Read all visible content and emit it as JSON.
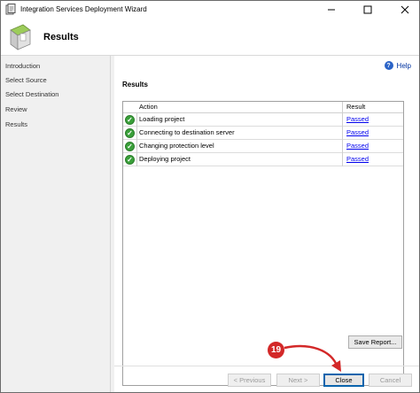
{
  "window": {
    "title": "Integration Services Deployment Wizard"
  },
  "header": {
    "title": "Results"
  },
  "nav": {
    "items": [
      {
        "label": "Introduction"
      },
      {
        "label": "Select Source"
      },
      {
        "label": "Select Destination"
      },
      {
        "label": "Review"
      },
      {
        "label": "Results"
      }
    ]
  },
  "content": {
    "help_label": "Help",
    "section_title": "Results",
    "columns": {
      "action": "Action",
      "result": "Result"
    },
    "rows": [
      {
        "action": "Loading project",
        "result": "Passed"
      },
      {
        "action": "Connecting to destination server",
        "result": "Passed"
      },
      {
        "action": "Changing protection level",
        "result": "Passed"
      },
      {
        "action": "Deploying project",
        "result": "Passed"
      }
    ],
    "save_report_label": "Save Report..."
  },
  "footer": {
    "previous_label": "< Previous",
    "next_label": "Next >",
    "close_label": "Close",
    "cancel_label": "Cancel"
  },
  "annotation": {
    "step_number": "19",
    "color": "#d32828"
  },
  "colors": {
    "success_green": "#3aa03a",
    "link_blue": "#0000ee",
    "accent_blue": "#0a64ad"
  }
}
